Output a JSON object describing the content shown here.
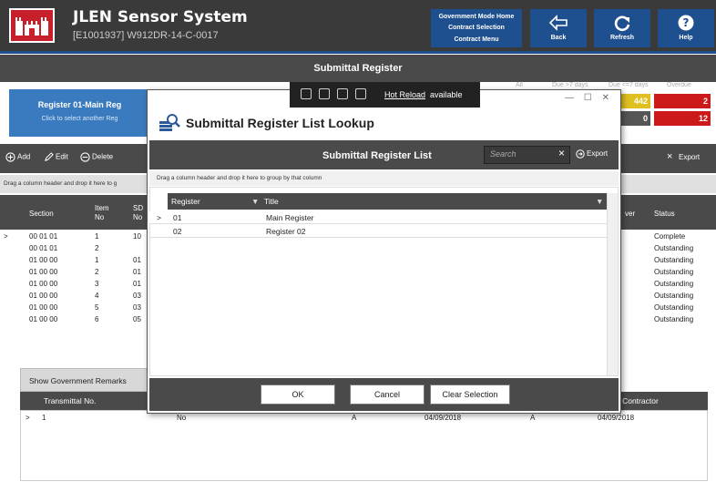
{
  "app": {
    "title": "JLEN Sensor System",
    "subtitle": "[E1001937] W912DR-14-C-0017",
    "gov_menu": [
      "Government Mode Home",
      "Contract Selection",
      "Contract Menu"
    ],
    "back_label": "Back",
    "refresh_label": "Refresh",
    "help_label": "Help",
    "page_title": "Submittal Register"
  },
  "background": {
    "selector_title": "Register 01-Main Reg",
    "selector_hint": "Click to select another Reg",
    "counts_headers": [
      "All",
      "Due >7 days",
      "Due <=7 days",
      "Overdue"
    ],
    "counts_row1": [
      "442",
      "2"
    ],
    "counts_row2": [
      "0",
      "12"
    ],
    "toolbar": {
      "add": "Add",
      "edit": "Edit",
      "delete": "Delete",
      "export": "Export",
      "clear": "×"
    },
    "drag_hint": "Drag a column header and drop it here to g",
    "grid_headers": {
      "section": "Section",
      "item_no": "Item No",
      "sd_no": "SD No",
      "approver": "ver",
      "status": "Status"
    },
    "rows": [
      {
        "section": "00 01 01",
        "item": "1",
        "sd": "10",
        "status": "Complete"
      },
      {
        "section": "00 01 01",
        "item": "2",
        "sd": "",
        "status": "Outstanding"
      },
      {
        "section": "01 00 00",
        "item": "1",
        "sd": "01",
        "status": "Outstanding"
      },
      {
        "section": "01 00 00",
        "item": "2",
        "sd": "01",
        "status": "Outstanding"
      },
      {
        "section": "01 00 00",
        "item": "3",
        "sd": "01",
        "status": "Outstanding"
      },
      {
        "section": "01 00 00",
        "item": "4",
        "sd": "03",
        "status": "Outstanding"
      },
      {
        "section": "01 00 00",
        "item": "5",
        "sd": "03",
        "status": "Outstanding"
      },
      {
        "section": "01 00 00",
        "item": "6",
        "sd": "05",
        "status": "Outstanding"
      }
    ],
    "remarks_label": "Show Government Remarks",
    "remarks_headers": {
      "transmittal": "Transmittal No.",
      "contractor": "o Contractor"
    },
    "remarks_row": {
      "transmittal": "1",
      "col2": "No",
      "col3": "A",
      "date1": "04/09/2018",
      "col5": "A",
      "date2": "04/09/2018"
    }
  },
  "hot_reload": {
    "link": "Hot Reload",
    "rest": "available"
  },
  "modal": {
    "title": "Submittal Register List Lookup",
    "list_title": "Submittal Register List",
    "search_placeholder": "Search",
    "search_clear": "×",
    "export_label": "Export",
    "drag_hint": "Drag a column header and drop it here to group by that column",
    "columns": {
      "register": "Register",
      "title": "Title"
    },
    "rows": [
      {
        "register": "01",
        "title": "Main Register"
      },
      {
        "register": "02",
        "title": "Register 02"
      }
    ],
    "ok_label": "OK",
    "cancel_label": "Cancel",
    "clear_label": "Clear Selection"
  },
  "colors": {
    "header_bg": "#3a3a3a",
    "accent_blue": "#1e4f8e",
    "logo_red": "#c8202a",
    "warn_yellow": "#e0c020",
    "danger_red": "#cc1a1a"
  }
}
